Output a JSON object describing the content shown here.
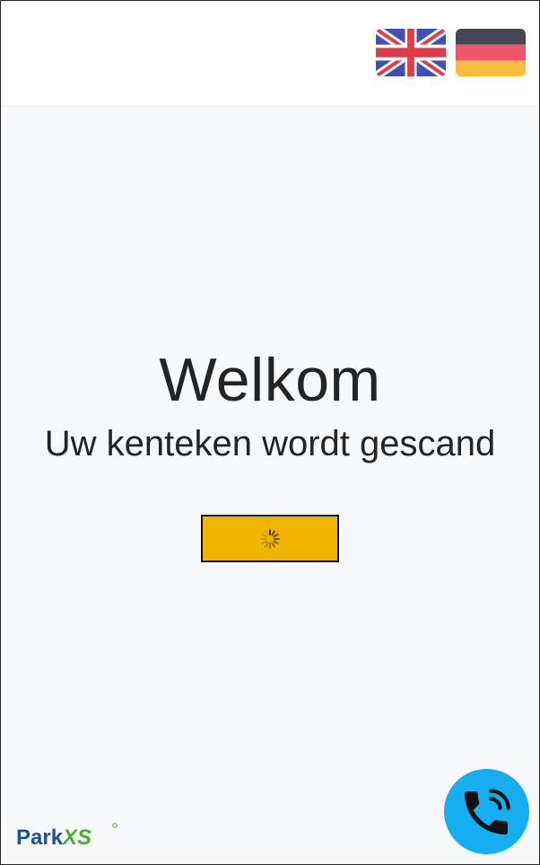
{
  "header": {
    "languages": [
      {
        "code": "en",
        "icon": "uk-flag-icon"
      },
      {
        "code": "de",
        "icon": "german-flag-icon"
      }
    ]
  },
  "main": {
    "title": "Welkom",
    "subtitle": "Uw kenteken wordt gescand",
    "plate_color": "#f1b500",
    "loading_icon": "spinner-icon"
  },
  "footer": {
    "logo": {
      "part1": "Park",
      "part2": "XS",
      "color1": "#1e4f9c",
      "color2": "#4caf2f"
    },
    "call_button": {
      "icon": "phone-call-icon",
      "color": "#16aef0"
    }
  }
}
